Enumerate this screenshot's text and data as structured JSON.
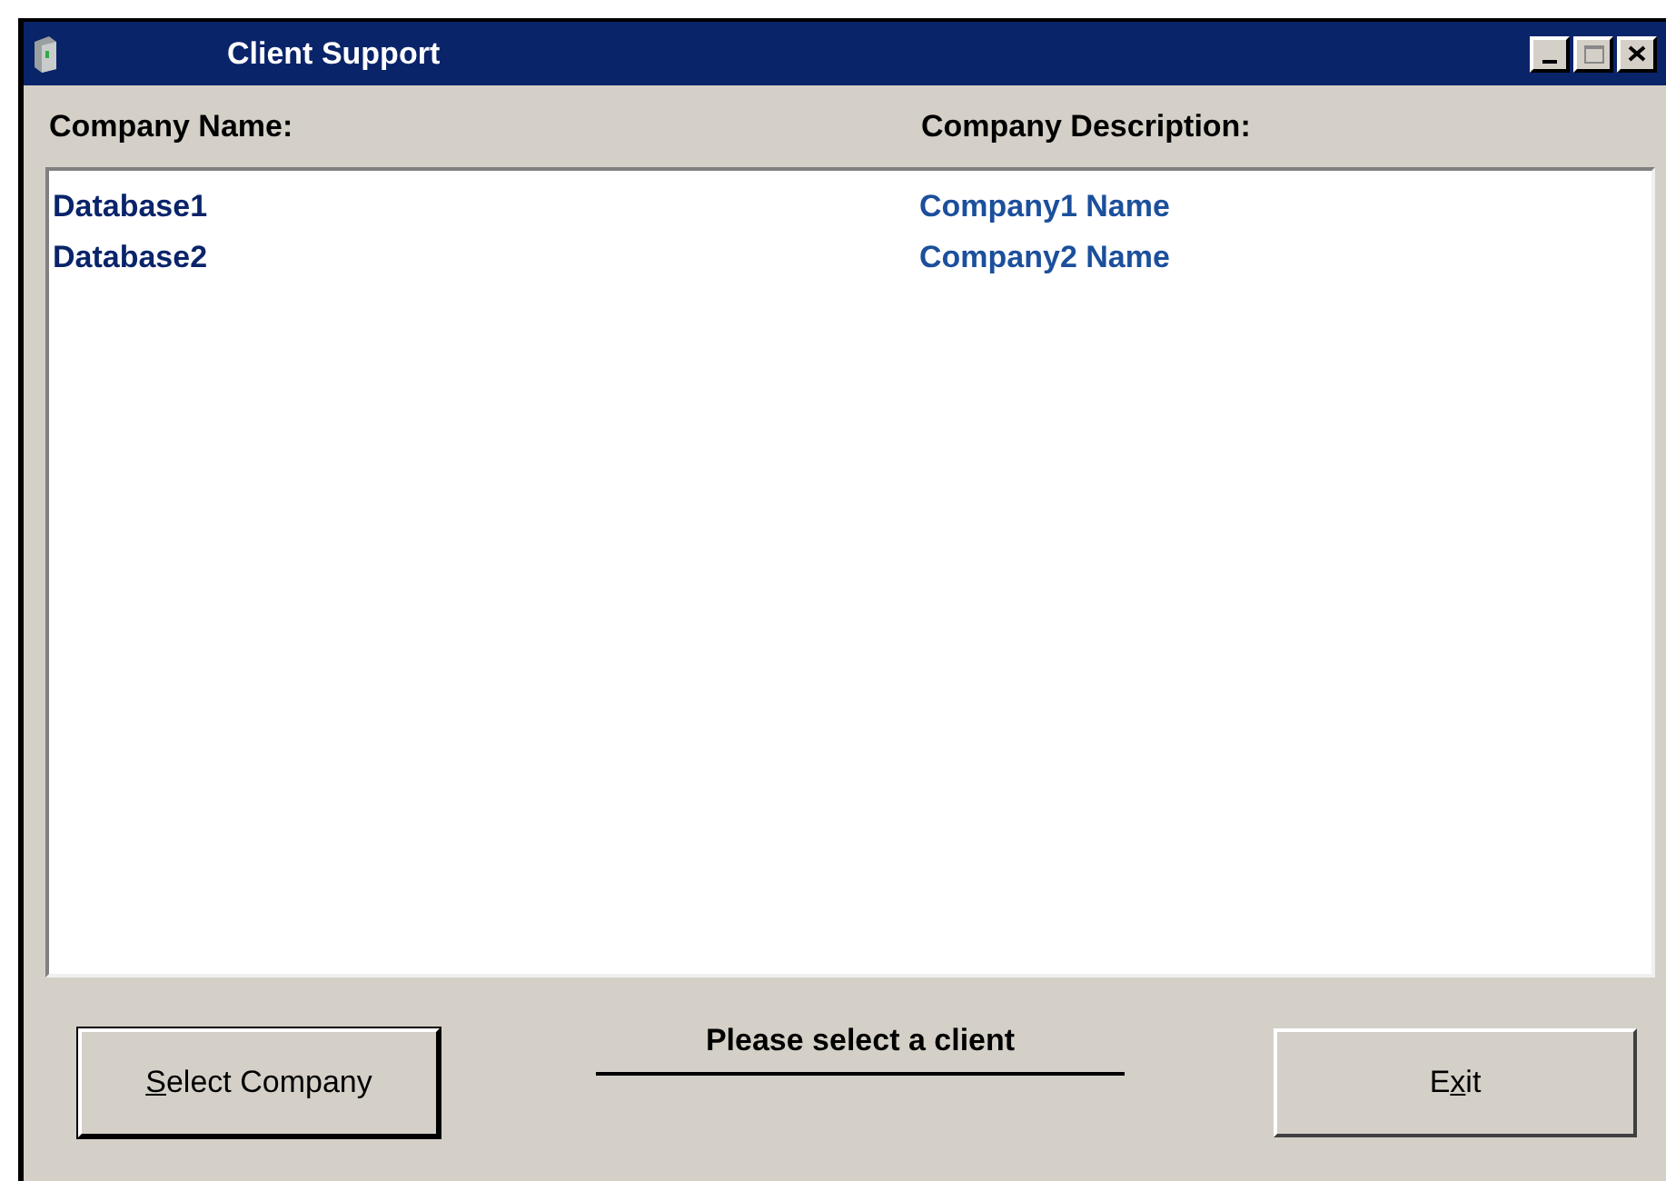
{
  "window": {
    "title": "Client Support"
  },
  "columns": [
    "Company Name:",
    "Company Description:"
  ],
  "rows": [
    {
      "name": "Database1",
      "description": "Company1 Name"
    },
    {
      "name": "Database2",
      "description": "Company2 Name"
    }
  ],
  "buttons": [
    {
      "key": "S",
      "after": "elect Company"
    },
    {
      "before": "E",
      "key": "x",
      "after": "it"
    }
  ],
  "status": "Please select a client"
}
